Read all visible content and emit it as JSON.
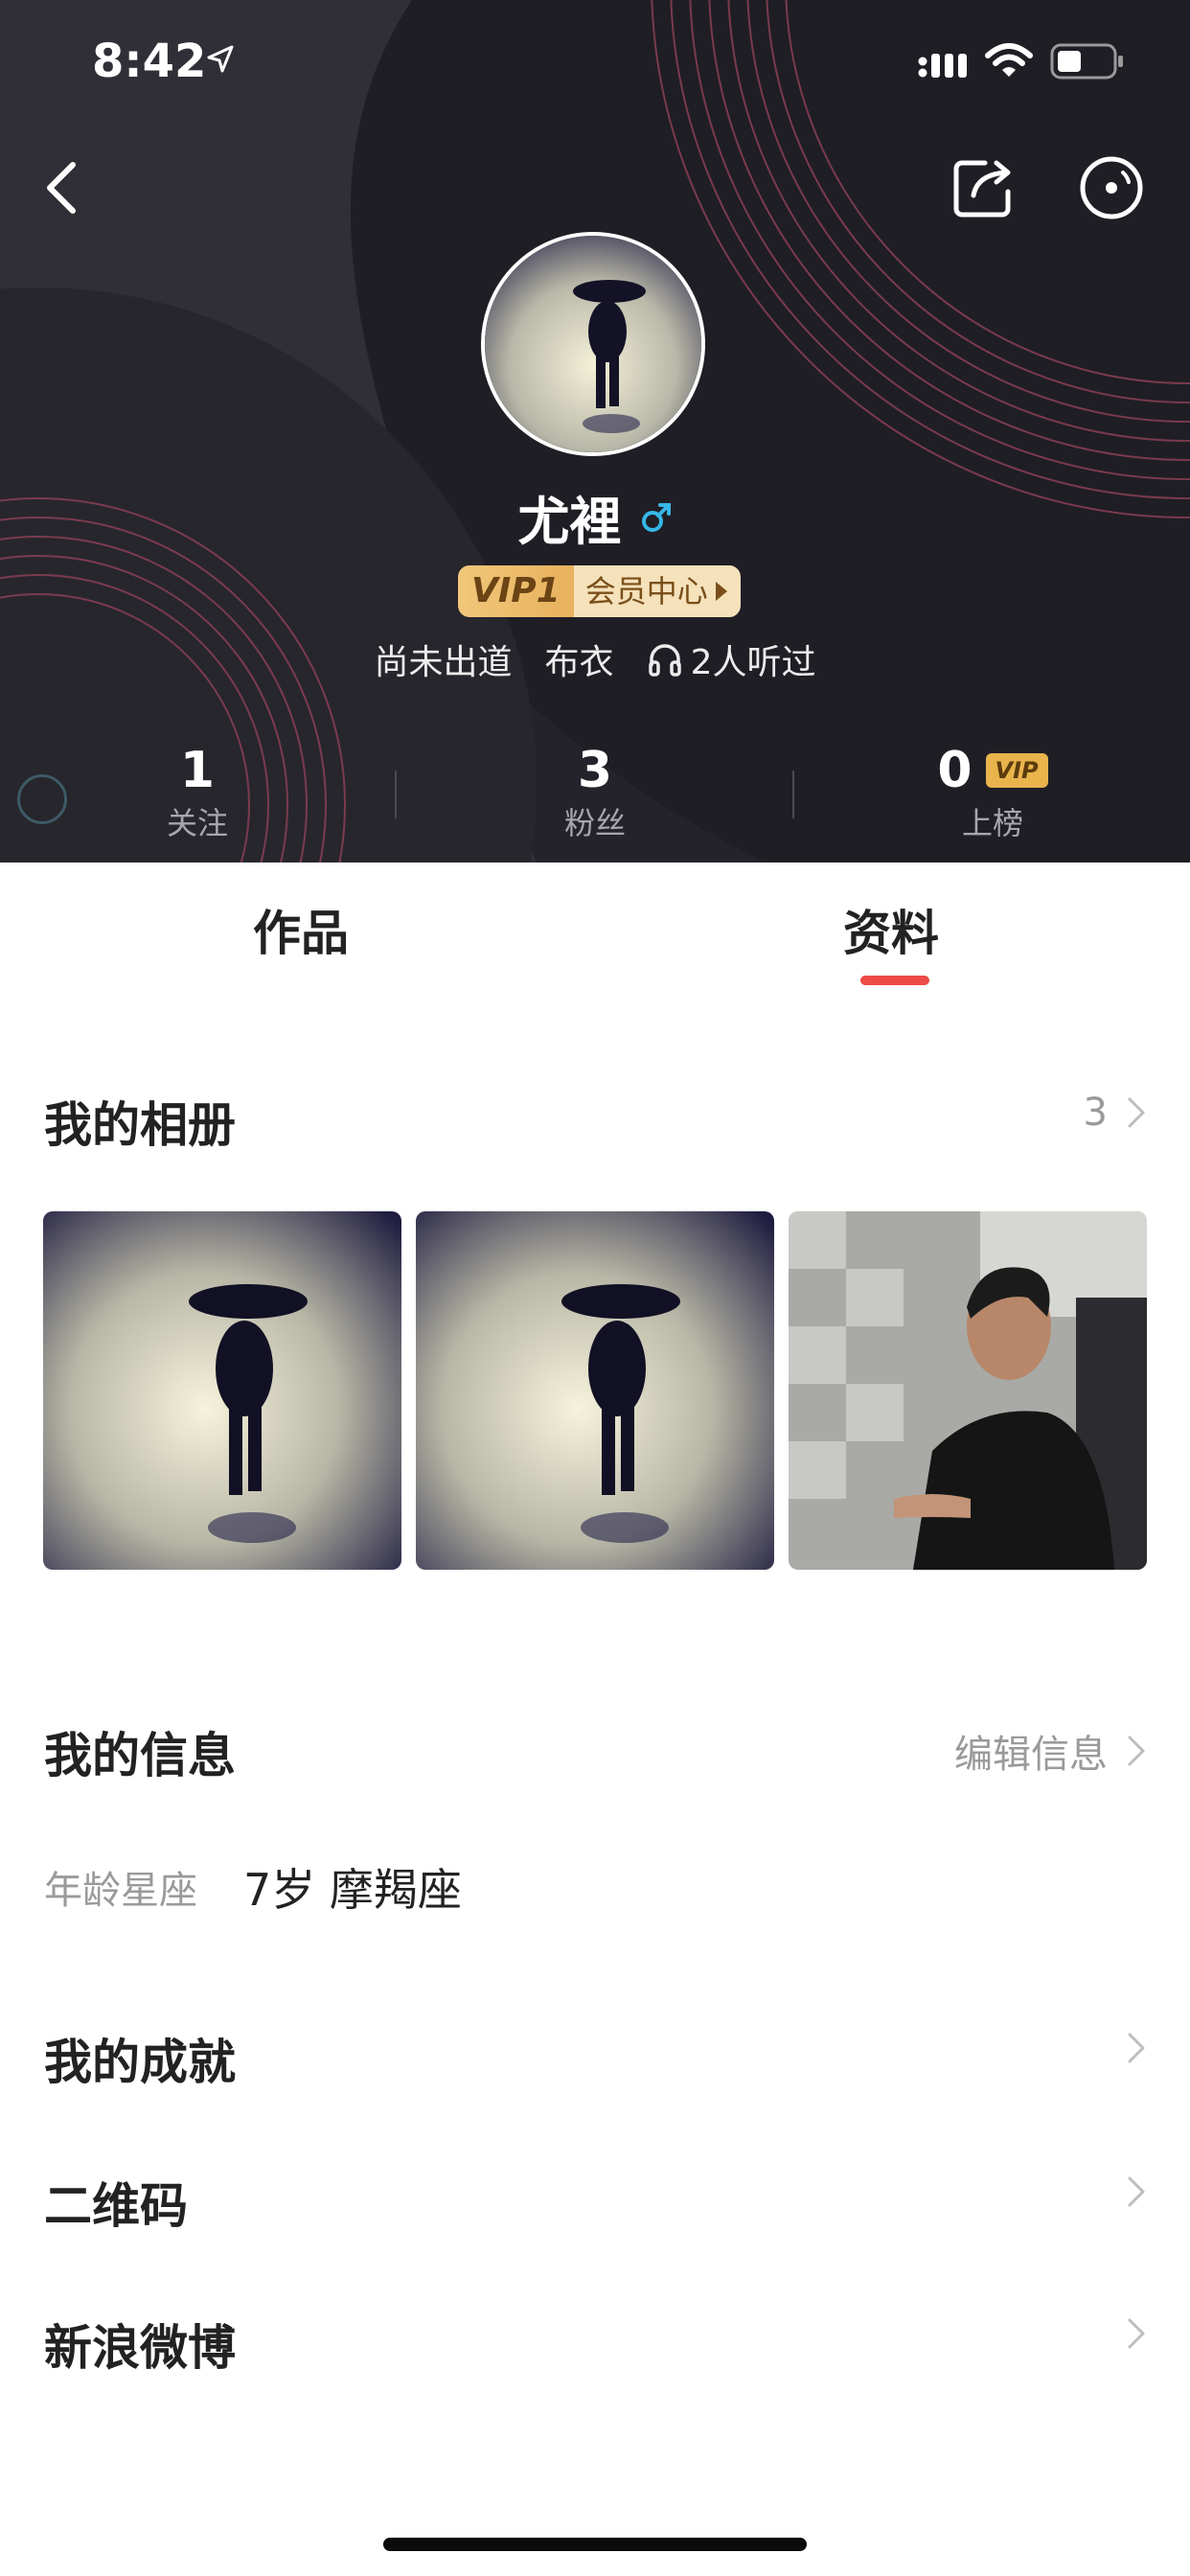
{
  "status_bar": {
    "time": "8:42"
  },
  "profile": {
    "name": "尤裡",
    "gender_symbol": "♂",
    "vip_level": "VIP1",
    "vip_center_label": "会员中心",
    "meta": {
      "debut": "尚未出道",
      "rank": "布衣",
      "listeners": "2人听过"
    }
  },
  "stats": [
    {
      "value": "1",
      "label": "关注"
    },
    {
      "value": "3",
      "label": "粉丝"
    },
    {
      "value": "0",
      "label": "上榜",
      "badge": "VIP"
    }
  ],
  "tabs": [
    {
      "label": "作品",
      "active": false
    },
    {
      "label": "资料",
      "active": true
    }
  ],
  "album": {
    "title": "我的相册",
    "count": "3"
  },
  "info": {
    "title": "我的信息",
    "edit_label": "编辑信息",
    "age_label": "年龄星座",
    "age_value": "7岁 摩羯座"
  },
  "rows": {
    "achievements": "我的成就",
    "qr_code": "二维码",
    "weibo": "新浪微博"
  },
  "colors": {
    "header_bg": "#24232b",
    "accent_red": "#ee4a47",
    "vip_gold": "#e9b44c",
    "gender_blue": "#35b7e8"
  },
  "icons": [
    "back-arrow-icon",
    "share-icon",
    "more-icon",
    "gender-male-icon",
    "headphones-icon",
    "chevron-right-icon",
    "location-arrow-icon",
    "signal-icon",
    "wifi-icon",
    "battery-icon"
  ]
}
